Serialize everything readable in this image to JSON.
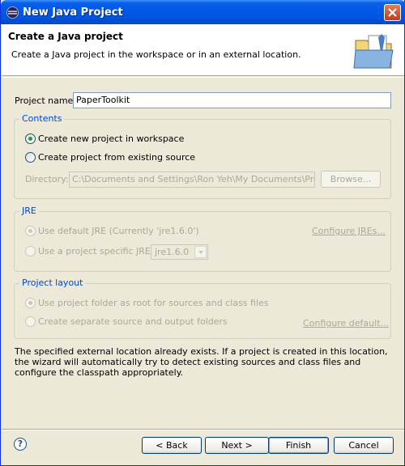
{
  "window": {
    "title": "New Java Project"
  },
  "banner": {
    "heading": "Create a Java project",
    "description": "Create a Java project in the workspace or in an external location."
  },
  "project": {
    "label": "Project name:",
    "value": "PaperToolkit"
  },
  "contents": {
    "title": "Contents",
    "option_new": "Create new project in workspace",
    "option_existing": "Create project from existing source",
    "directory_label": "Directory:",
    "directory_value": "C:\\Documents and Settings\\Ron Yeh\\My Documents\\Projects\\",
    "browse_label": "Browse..."
  },
  "jre": {
    "title": "JRE",
    "option_default": "Use default JRE (Currently 'jre1.6.0')",
    "configure_link": "Configure JREs...",
    "option_specific": "Use a project specific JRE:",
    "specific_value": "jre1.6.0"
  },
  "layout": {
    "title": "Project layout",
    "option_root": "Use project folder as root for sources and class files",
    "option_separate": "Create separate source and output folders",
    "configure_link": "Configure default..."
  },
  "message": "The specified external location already exists. If a project is created in this location, the wizard will automatically try to detect existing sources and class files and configure the classpath appropriately.",
  "buttons": {
    "help": "?",
    "back": "< Back",
    "next": "Next >",
    "finish": "Finish",
    "cancel": "Cancel"
  }
}
